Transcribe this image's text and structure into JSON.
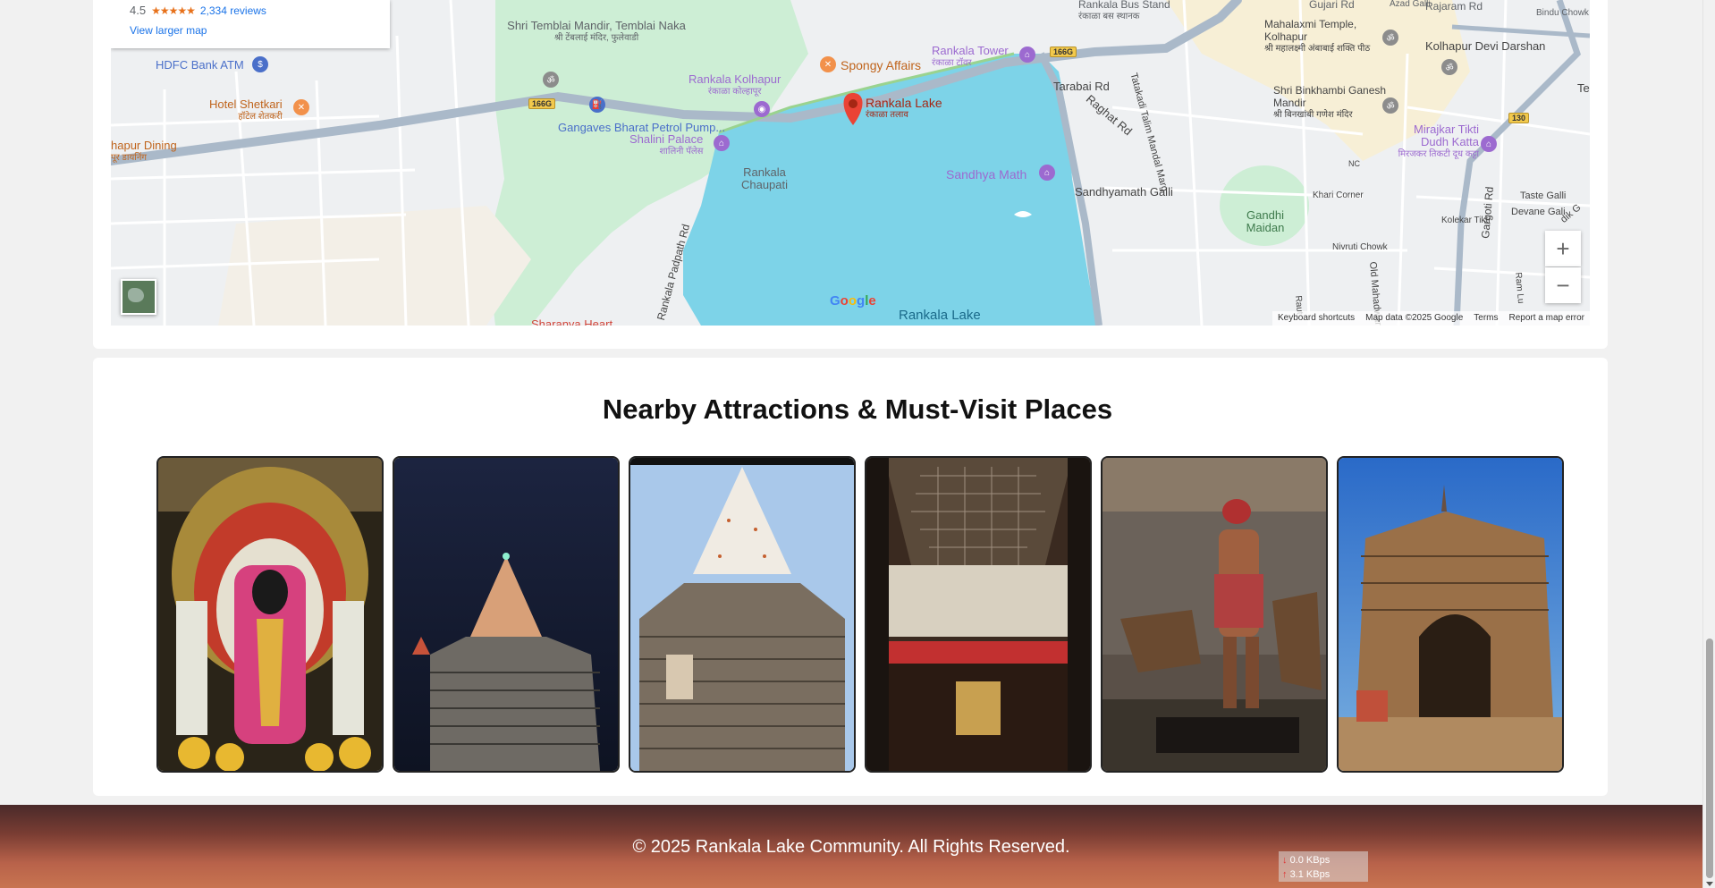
{
  "map": {
    "rating": "4.5",
    "stars": "★★★★★",
    "reviews": "2,334 reviews",
    "view_larger": "View larger map",
    "labels": {
      "bus_stand": "Rankala Bus Stand",
      "bus_stand_sub": "रंकाळा बस स्थानक",
      "gujari": "Gujari Rd",
      "azad": "Azad Galli",
      "rajaram": "Rajaram Rd",
      "bindu": "Bindu Chowk",
      "temblai": "Shri Temblai Mandir, Temblai Naka",
      "temblai_sub": "श्री टेंबलाई मंदिर, फुलेवाडी",
      "hdfc": "HDFC Bank ATM",
      "shetkari": "Hotel Shetkari",
      "shetkari_sub": "हॉटेल शेतकरी",
      "dining": "hapur Dining",
      "dining_sub": "पूर डायनिंग",
      "spongy": "Spongy Affairs",
      "rankala_kolhapur": "Rankala Kolhapur",
      "rankala_kolhapur_sub": "रंकाळा कोल्हापूर",
      "rankala_tower": "Rankala Tower",
      "rankala_tower_sub": "रंकाळा टॉवर",
      "rankala_lake": "Rankala Lake",
      "rankala_lake_sub": "रंकाळा तलाव",
      "gangaves": "Gangaves Bharat Petrol Pump...",
      "shalini": "Shalini Palace",
      "shalini_sub": "शालिनी पॅलेस",
      "chaupati": "Rankala Chaupati",
      "sandhya": "Sandhya Math",
      "sandhyamath_galli": "Sandhyamath Galli",
      "tarabai": "Tarabai Rd",
      "raghat": "Raghat Rd",
      "tatakadi": "Tatakadi Talim Mandal Marg",
      "mahalaxmi": "Mahalaxmi Temple, Kolhapur",
      "mahalaxmi_sub": "श्री महालक्ष्मी अंबाबाई शक्ति पीठ",
      "binkhambi": "Shri Binkhambi Ganesh Mandir",
      "binkhambi_sub": "श्री बिनखांबी गणेश मंदिर",
      "devi_darshan": "Kolhapur Devi Darshan",
      "mirajkar": "Mirajkar Tikti Dudh Katta",
      "mirajkar_sub": "मिरजकर तिकटी दूध कट्टा",
      "gandhi": "Gandhi Maidan",
      "khari": "Khari Corner",
      "taste": "Taste Galli",
      "devane": "Devane Gali",
      "kolekar": "Kolekar Tikti",
      "nivruti": "Nivruti Chowk",
      "old_mahadwar": "Old Mahadwar",
      "gargoti": "Gargoti Rd",
      "padpath": "Rankala Padpath Rd",
      "sharanya": "Sharanya Heart",
      "lake_bottom": "Rankala Lake",
      "nc": "NC",
      "raut": "Raut",
      "ram_lu": "Ram Lu",
      "te": "Te",
      "dik": "dik G"
    },
    "shields": [
      "166G",
      "166G",
      "130"
    ],
    "zoom_in": "+",
    "zoom_out": "−",
    "google": [
      "G",
      "o",
      "o",
      "g",
      "l",
      "e"
    ],
    "attribution": [
      "Keyboard shortcuts",
      "Map data ©2025 Google",
      "Terms",
      "Report a map error"
    ]
  },
  "attractions": {
    "title": "Nearby Attractions & Must-Visit Places",
    "items": [
      {
        "icon": "deity-idol-image"
      },
      {
        "icon": "temple-night-image"
      },
      {
        "icon": "temple-day-image"
      },
      {
        "icon": "palace-interior-image"
      },
      {
        "icon": "museum-exhibit-image"
      },
      {
        "icon": "stone-gateway-image"
      }
    ]
  },
  "footer": {
    "copyright": "© 2025 Rankala Lake Community. All Rights Reserved."
  },
  "net_meter": {
    "down": "0.0 KBps",
    "up": "3.1 KBps"
  },
  "colors": {
    "lake": "#7dd3e8",
    "road": "#aab9c9",
    "park": "#cdeed5",
    "pin": "#ea4335",
    "poi_purple": "#9c6ad0",
    "poi_orange": "#f2914b",
    "poi_blue": "#4a6fc9"
  }
}
